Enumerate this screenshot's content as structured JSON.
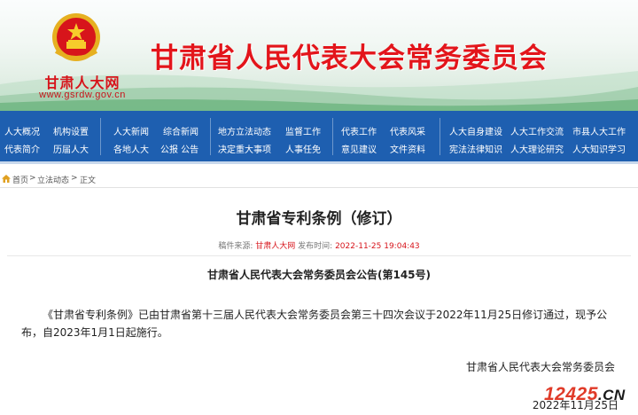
{
  "banner": {
    "site_name": "甘肃人大网",
    "site_url": "www.gsrdw.gov.cn",
    "title": "甘肃省人民代表大会常务委员会"
  },
  "nav": {
    "groups": [
      {
        "row1": [
          "人大概况",
          "机构设置"
        ],
        "row2": [
          "代表简介",
          "历届人大"
        ]
      },
      {
        "row1": [
          "人大新闻",
          "综合新闻"
        ],
        "row2": [
          "各地人大",
          "公报 公告"
        ]
      },
      {
        "row1": [
          "地方立法动态",
          "监督工作"
        ],
        "row2": [
          "决定重大事项",
          "人事任免"
        ]
      },
      {
        "row1": [
          "代表工作",
          "代表风采"
        ],
        "row2": [
          "意见建议",
          "文件资料"
        ]
      },
      {
        "row1": [
          "人大自身建设",
          "人大工作交流",
          "市县人大工作"
        ],
        "row2": [
          "宪法法律知识",
          "人大理论研究",
          "人大知识学习"
        ]
      }
    ]
  },
  "breadcrumb": {
    "home": "首页",
    "sep1": ">",
    "section": "立法动态",
    "sep2": ">",
    "current": "正文"
  },
  "article": {
    "title": "甘肃省专利条例（修订）",
    "source_label": "稿件来源:",
    "source": "甘肃人大网",
    "time_label": "发布时间:",
    "time": "2022-11-25 19:04:43",
    "subtitle": "甘肃省人民代表大会常务委员会公告(第145号)",
    "paragraph": "《甘肃省专利条例》已由甘肃省第十三届人民代表大会常务委员会第三十四次会议于2022年11月25日修订通过，现予公布，自2023年1月1日起施行。",
    "signature": "甘肃省人民代表大会常务委员会",
    "date": "2022年11月25日"
  },
  "watermark": {
    "num": "12425",
    "suffix": ".CN"
  },
  "colors": {
    "nav_bg": "#1e5fb0",
    "banner_red": "#e3151b",
    "link_red": "#d7141b"
  },
  "icons": {
    "home": "home-icon",
    "emblem": "national-emblem-icon"
  }
}
